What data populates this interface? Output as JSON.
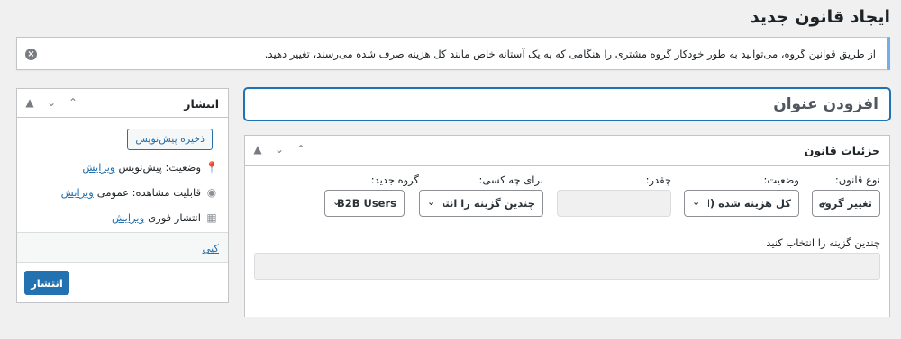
{
  "page": {
    "title": "ایجاد قانون جدید"
  },
  "notice": {
    "text": "از طریق قوانین گروه، می‌توانید به طور خودکار گروه مشتری را هنگامی که به یک آستانه خاص مانند کل هزینه صرف شده می‌رسند، تغییر دهید.",
    "dismiss_icon": "close-icon"
  },
  "title_field": {
    "placeholder": "افزودن عنوان"
  },
  "details": {
    "title": "جزئیات قانون",
    "fields": {
      "rule_type": {
        "label": "نوع قانون:",
        "value": "تغییر گروه"
      },
      "condition": {
        "label": "وضعیت:",
        "value": "کل هزینه شده (ارزش کل"
      },
      "amount": {
        "label": "چقدر:",
        "value": ""
      },
      "for_whom": {
        "label": "برای چه کسی:",
        "value": "چندین گزینه را انتخاب کنید"
      },
      "new_group": {
        "label": "گروه جدید:",
        "value": "B2B Users"
      }
    },
    "multi_select": {
      "label": "چندین گزینه را انتخاب کنید"
    }
  },
  "publish": {
    "title": "انتشار",
    "save_draft": "ذخیره پیش‌نویس",
    "status_label": "وضعیت: پیش‌نویس",
    "status_edit": "ویرایش",
    "visibility_label": "قابلیت مشاهده: عمومی",
    "visibility_edit": "ویرایش",
    "schedule_label": "انتشار فوری",
    "schedule_edit": "ویرایش",
    "copy_link": "کپی",
    "publish_button": "انتشار"
  },
  "colors": {
    "accent": "#2271b1",
    "notice_border": "#72aee6",
    "background": "#f0f0f1"
  }
}
